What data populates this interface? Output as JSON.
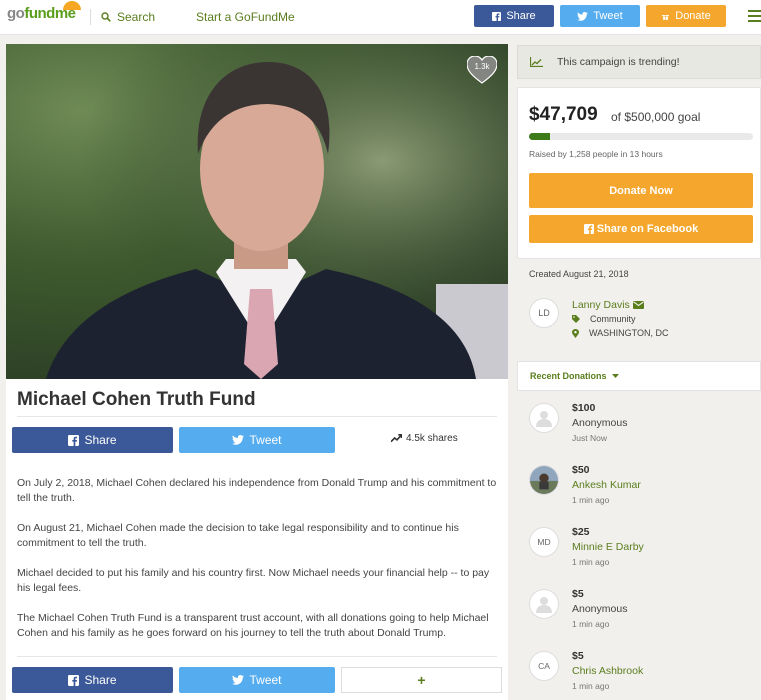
{
  "header": {
    "logo": {
      "go": "go",
      "fund": "fund",
      "me": "me"
    },
    "search_label": "Search",
    "start_label": "Start a GoFundMe",
    "share_label": "Share",
    "tweet_label": "Tweet",
    "donate_label": "Donate",
    "icons": [
      "search-icon",
      "facebook-icon",
      "twitter-icon",
      "donate-icon",
      "hamburger-menu-icon"
    ]
  },
  "campaign": {
    "title": "Michael Cohen Truth Fund",
    "hearts": "1.3k",
    "share_label": "Share",
    "tweet_label": "Tweet",
    "shares_count": "4.5k shares",
    "paragraphs": [
      "On July 2, 2018, Michael Cohen declared his independence from Donald Trump and his commitment to tell the truth.",
      "On August 21, Michael Cohen made the decision to take legal responsibility and to continue his commitment to tell the truth.",
      "Michael decided to put his family and his country first.  Now Michael needs your financial help -- to pay his legal fees.",
      "The Michael Cohen Truth Fund is a transparent trust account, with all donations going to help Michael Cohen and his family as he goes forward on his journey to tell the truth about Donald Trump."
    ],
    "bottom_share_label": "Share",
    "bottom_tweet_label": "Tweet",
    "more_label": "+"
  },
  "sidebar": {
    "trending": "This campaign is trending!",
    "raised": "$47,709",
    "goal": "of $500,000 goal",
    "progress_fraction": 0.095,
    "raised_by": "Raised by 1,258 people in 13 hours",
    "donate_now": "Donate Now",
    "share_facebook": "Share on Facebook",
    "created": "Created August 21, 2018",
    "organizer": {
      "initials": "LD",
      "name": "Lanny Davis",
      "category": "Community",
      "location": "WASHINGTON, DC"
    },
    "recent_label": "Recent Donations",
    "donations": [
      {
        "amount": "$100",
        "name": "Anonymous",
        "time": "Just Now",
        "avatar": "person-icon",
        "initials": ""
      },
      {
        "amount": "$50",
        "name": "Ankesh Kumar",
        "time": "1 min ago",
        "avatar": "photo",
        "initials": ""
      },
      {
        "amount": "$25",
        "name": "Minnie E Darby",
        "time": "1 min ago",
        "avatar": "initials",
        "initials": "MD"
      },
      {
        "amount": "$5",
        "name": "Anonymous",
        "time": "1 min ago",
        "avatar": "person-icon",
        "initials": ""
      },
      {
        "amount": "$5",
        "name": "Chris Ashbrook",
        "time": "1 min ago",
        "avatar": "initials",
        "initials": "CA"
      }
    ]
  },
  "colors": {
    "facebook": "#3b5998",
    "twitter": "#55acee",
    "donate": "#f4a72c",
    "brand_green": "#5a7d1e",
    "progress": "#3c7a1a"
  }
}
